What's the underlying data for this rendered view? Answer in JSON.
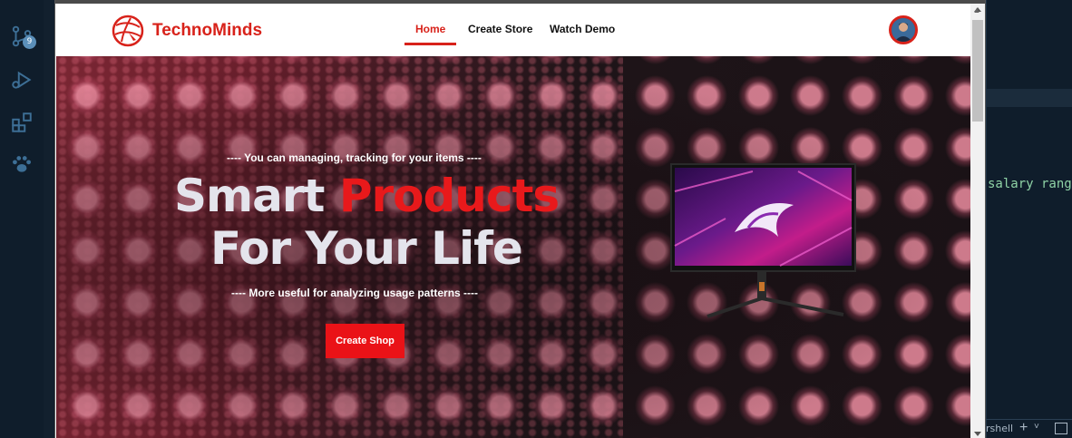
{
  "editor_bg": {
    "activity_badge": "9",
    "code_snippet": "salary rang",
    "terminal_label": "rshell",
    "terminal_plus": "+",
    "terminal_chevron": "˅"
  },
  "navbar": {
    "brand": "TechnoMinds",
    "links": [
      "Home",
      "Create Store",
      "Watch Demo"
    ],
    "active_link": "Home",
    "avatar_icon": "user-avatar"
  },
  "hero": {
    "tagline_top": "---- You can managing, tracking for your items ----",
    "headline_word1": "Smart",
    "headline_word2": "Products",
    "headline_line2": "For Your Life",
    "tagline_bottom": "---- More useful for analyzing usage patterns ----",
    "cta_label": "Create Shop"
  },
  "colors": {
    "accent": "#e8191b",
    "brand_red": "#d8221a",
    "headline_light": "#e4e4ec"
  }
}
